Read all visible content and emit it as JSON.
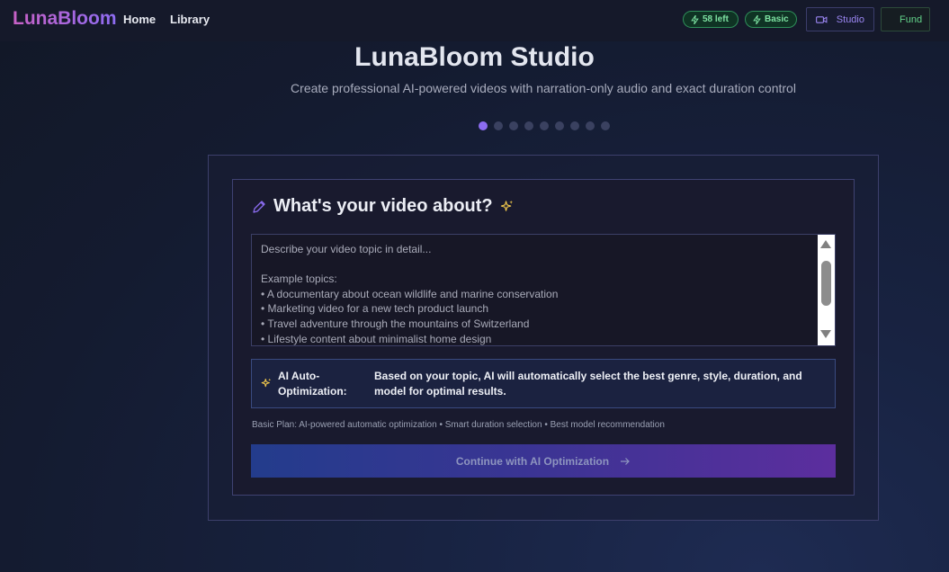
{
  "nav": {
    "logo": "LunaBloom",
    "links": [
      "Home",
      "Library"
    ],
    "credits_badge": "58 left",
    "plan_badge": "Basic",
    "studio_button": "Studio",
    "fund_button": "Fund"
  },
  "hero": {
    "title": "LunaBloom Studio",
    "subtitle": "Create professional AI-powered videos with narration-only audio and exact duration control",
    "steps_total": 9,
    "active_step": 1
  },
  "form": {
    "heading": "What's your video about?",
    "topic_placeholder": "Describe your video topic in detail...\n\nExample topics:\n• A documentary about ocean wildlife and marine conservation\n• Marketing video for a new tech product launch\n• Travel adventure through the mountains of Switzerland\n• Lifestyle content about minimalist home design",
    "topic_value": "",
    "optimization_label": "AI Auto-Optimization:",
    "optimization_text": "Based on your topic, AI will automatically select the best genre, style, duration, and model for optimal results.",
    "plan_note": "Basic Plan: AI-powered automatic optimization • Smart duration selection • Best model recommendation",
    "continue_button": "Continue with AI Optimization"
  },
  "colors": {
    "accent": "#8b6cf0",
    "success": "#7ee2a2",
    "background": "#141b30",
    "sparkle": "#f2c94c"
  },
  "icons": {
    "credits": "bolt-icon",
    "plan": "bolt-icon",
    "studio": "video-camera-icon",
    "fund": "dollar-icon",
    "heading": "pencil-icon",
    "sparkle": "sparkles-icon",
    "cta": "arrow-right-icon"
  }
}
